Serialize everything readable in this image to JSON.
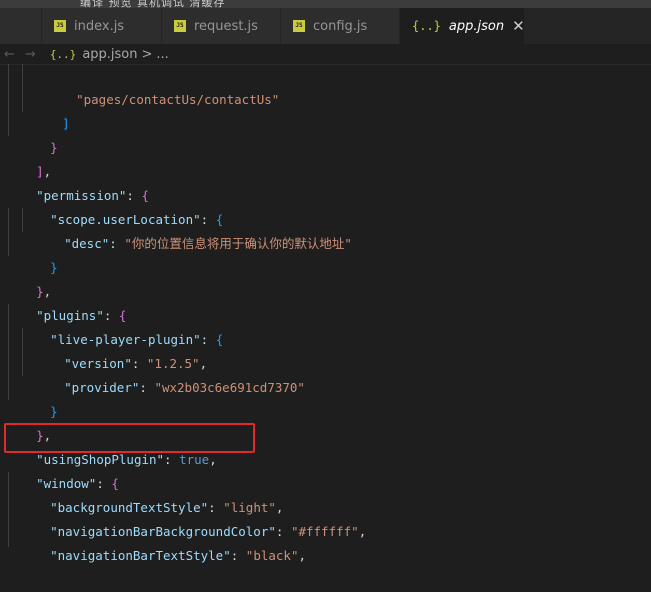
{
  "menu": {
    "text": "编译  预览  真机调试  清缓存"
  },
  "tabs": [
    {
      "label": "",
      "icon": "js"
    },
    {
      "label": "index.js",
      "icon": "js"
    },
    {
      "label": "request.js",
      "icon": "js"
    },
    {
      "label": "config.js",
      "icon": "js"
    },
    {
      "label": "app.json",
      "icon": "json",
      "active": true
    }
  ],
  "icons": {
    "js": "JS",
    "json": "{..}",
    "close": "✕",
    "back": "←",
    "forward": "→"
  },
  "breadcrumb": {
    "file": "app.json",
    "separator": ">",
    "rest": "..."
  },
  "code": {
    "l1": {
      "str": "\"pages/contactUs/contactUs\""
    },
    "l2": {
      "bracket": "]"
    },
    "l3": {
      "brace": "}"
    },
    "l4": {
      "bracket": "]",
      "comma": ","
    },
    "l5": {
      "key": "\"permission\"",
      "colon": ": ",
      "brace": "{"
    },
    "l6": {
      "key": "\"scope.userLocation\"",
      "colon": ": ",
      "brace": "{"
    },
    "l7": {
      "key": "\"desc\"",
      "colon": ": ",
      "str": "\"你的位置信息将用于确认你的默认地址\""
    },
    "l8": {
      "brace": "}"
    },
    "l9": {
      "brace": "}",
      "comma": ","
    },
    "l10": {
      "key": "\"plugins\"",
      "colon": ": ",
      "brace": "{"
    },
    "l11": {
      "key": "\"live-player-plugin\"",
      "colon": ": ",
      "brace": "{"
    },
    "l12": {
      "key": "\"version\"",
      "colon": ": ",
      "str": "\"1.2.5\"",
      "comma": ","
    },
    "l13": {
      "key": "\"provider\"",
      "colon": ": ",
      "str": "\"wx2b03c6e691cd7370\""
    },
    "l14": {
      "brace": "}"
    },
    "l15": {
      "brace": "}",
      "comma": ","
    },
    "l16": {
      "key": "\"usingShopPlugin\"",
      "colon": ": ",
      "bool": "true",
      "comma": ","
    },
    "l17": {
      "key": "\"window\"",
      "colon": ": ",
      "brace": "{"
    },
    "l18": {
      "key": "\"backgroundTextStyle\"",
      "colon": ": ",
      "str": "\"light\"",
      "comma": ","
    },
    "l19": {
      "key": "\"navigationBarBackgroundColor\"",
      "colon": ": ",
      "str": "\"#ffffff\"",
      "comma": ","
    },
    "l20": {
      "key": "\"navigationBarTextStyle\"",
      "colon": ": ",
      "str": "\"black\"",
      "comma": ","
    }
  },
  "colors": {
    "editor_bg": "#1e1e1e",
    "key": "#9cdcfe",
    "string": "#ce9178",
    "boolean": "#569cd6",
    "highlight_border": "#e32a2a",
    "js_icon": "#cbcb41"
  }
}
